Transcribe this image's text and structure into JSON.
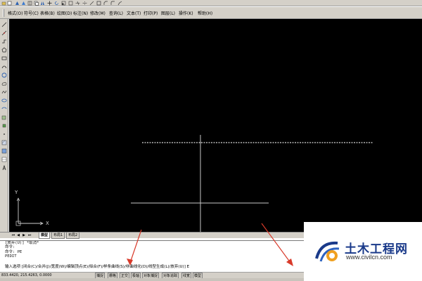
{
  "menubar": {
    "items": [
      "格式(O)",
      "符号(C)",
      "表格(B)",
      "绘图(D)",
      "标注(N)",
      "修改(M)",
      "查询(L)",
      "文本(T)",
      "打印(P)",
      "图层(L)",
      "操作(K)",
      "帮助(H)"
    ]
  },
  "layout_tabs": {
    "tabs": [
      "模型",
      "布局1",
      "布局2"
    ],
    "active": "模型"
  },
  "ucs": {
    "y_label": "Y",
    "x_label": "X"
  },
  "command": {
    "history": [
      "[放弃(U)]  *取消*",
      "命令:",
      "命令: PE",
      "PEDIT"
    ],
    "prompt": "输入选项 [闭合(C)/合并(J)/宽度(W)/编辑顶点(E)/拟合(F)/样条曲线(S)/非曲线化(D)/线型生成(L)/放弃(U)]  E"
  },
  "status": {
    "coordinates": "833.4420,  215.4263,  0.0000",
    "toggles": [
      "捕捉",
      "栅格",
      "正交",
      "极轴",
      "对象捕捉",
      "对象追踪",
      "线宽",
      "模型"
    ]
  },
  "watermark": {
    "title": "土木工程网",
    "url": "www.civilcn.com"
  },
  "colors": {
    "canvas": "#000000",
    "panel": "#d4d0c8",
    "annotation_arrow": "#d83a2a",
    "logo_blue": "#1a3a8a",
    "logo_orange": "#f0a020"
  }
}
